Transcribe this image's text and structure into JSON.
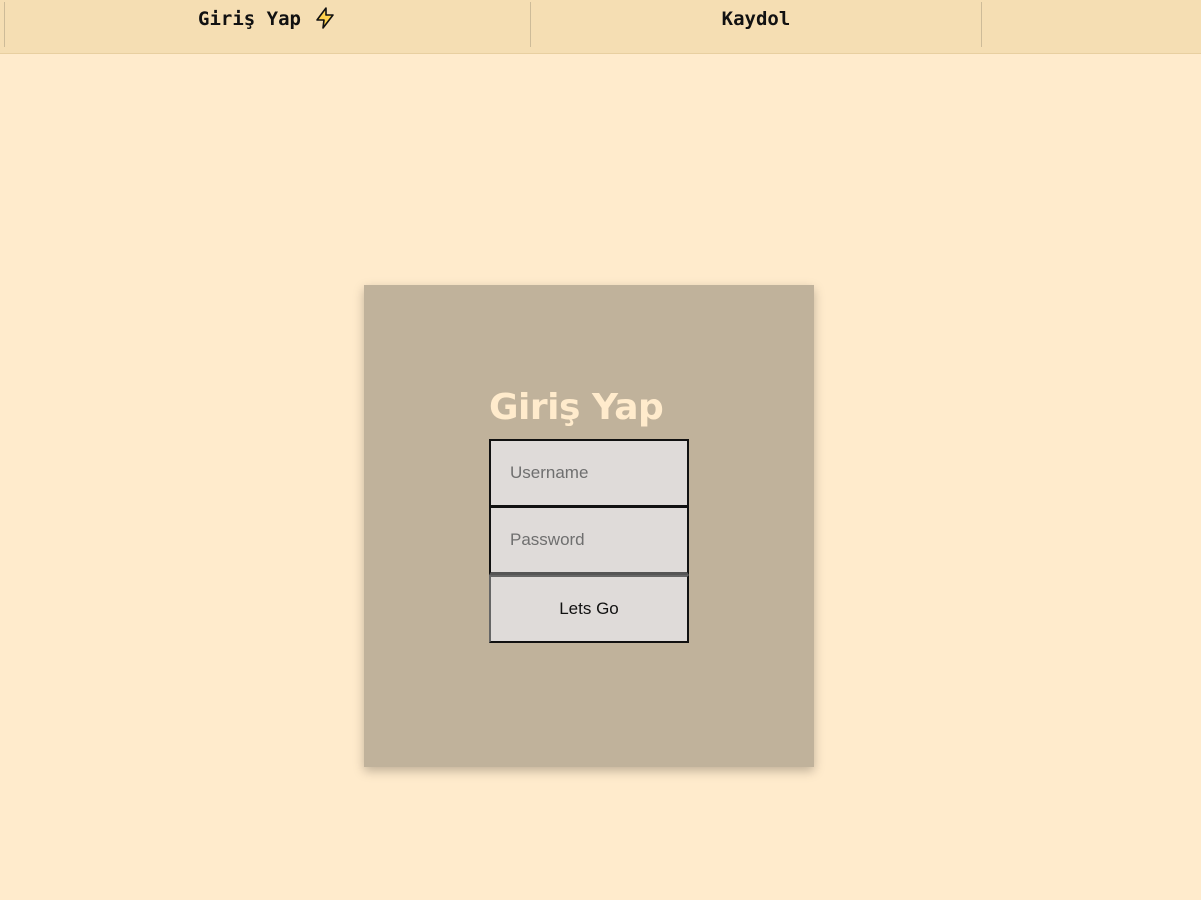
{
  "nav": {
    "login_tab": "Giriş Yap",
    "login_icon": "lightning-icon",
    "register_tab": "Kaydol"
  },
  "login_form": {
    "title": "Giriş Yap",
    "username_placeholder": "Username",
    "password_placeholder": "Password",
    "submit_label": "Lets Go"
  },
  "colors": {
    "page_background": "#ffebcc",
    "nav_background": "#f5deb3",
    "card_background": "#c0b29b",
    "title_color": "#ffebcc",
    "input_background": "#dfdbd9",
    "icon_fill": "#ffd24d"
  }
}
